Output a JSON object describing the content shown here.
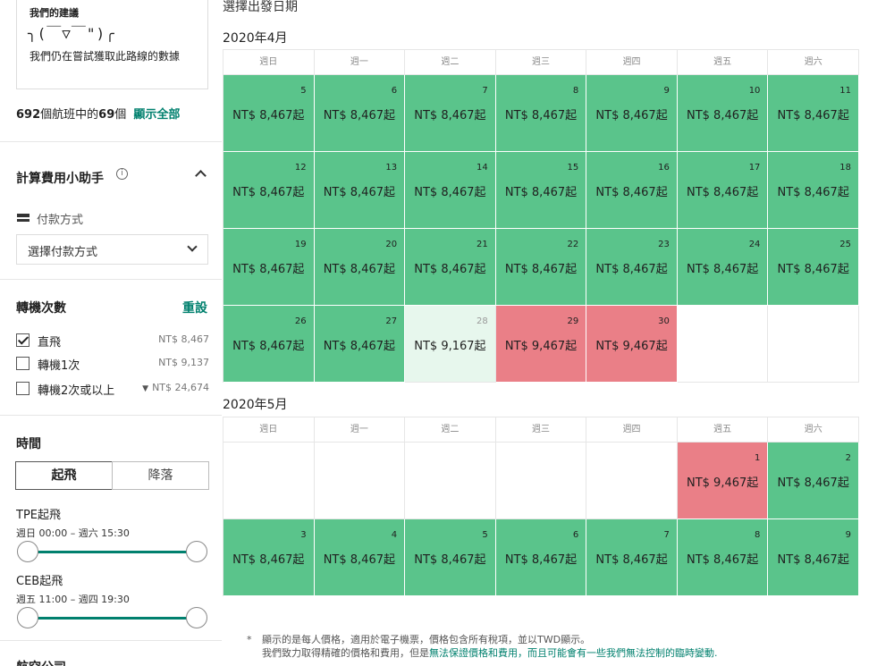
{
  "sidebar": {
    "suggestion": {
      "title": "我們的建議",
      "face": "╮(￣▽￣\")╭",
      "text": "我們仍在嘗試獲取此路線的數據"
    },
    "flight_count": {
      "total": "692",
      "text1": "個航班中的",
      "shown": "69",
      "text2": "個",
      "show_all": "顯示全部"
    },
    "calculator": {
      "title": "計算費用小助手",
      "info_icon": "info-icon",
      "payment_label": "付款方式",
      "payment_placeholder": "選擇付款方式"
    },
    "stops": {
      "title": "轉機次數",
      "reset": "重設",
      "options": [
        {
          "label": "直飛",
          "price": "NT$ 8,467",
          "checked": true
        },
        {
          "label": "轉機1次",
          "price": "NT$ 9,137",
          "checked": false
        },
        {
          "label": "轉機2次或以上",
          "price": "NT$ 24,674",
          "checked": false,
          "filter_icon": "▼"
        }
      ]
    },
    "time": {
      "title": "時間",
      "tab_depart": "起飛",
      "tab_arrive": "降落",
      "ranges": [
        {
          "title": "TPE起飛",
          "sub": "週日 00:00 – 週六 15:30"
        },
        {
          "title": "CEB起飛",
          "sub": "週五 11:00 – 週四 19:30"
        }
      ]
    },
    "airlines_title": "航空公司"
  },
  "calendar": {
    "heading": "選擇出發日期",
    "weekdays": [
      "週日",
      "週一",
      "週二",
      "週三",
      "週四",
      "週五",
      "週六"
    ],
    "colors": {
      "green": "#5ac48b",
      "light": "#e7f7ed",
      "red": "#ea7f87"
    },
    "months": [
      {
        "label": "2020年4月",
        "cells": [
          {
            "day": "5",
            "price": "NT$ 8,467起",
            "level": "green"
          },
          {
            "day": "6",
            "price": "NT$ 8,467起",
            "level": "green"
          },
          {
            "day": "7",
            "price": "NT$ 8,467起",
            "level": "green"
          },
          {
            "day": "8",
            "price": "NT$ 8,467起",
            "level": "green"
          },
          {
            "day": "9",
            "price": "NT$ 8,467起",
            "level": "green"
          },
          {
            "day": "10",
            "price": "NT$ 8,467起",
            "level": "green"
          },
          {
            "day": "11",
            "price": "NT$ 8,467起",
            "level": "green"
          },
          {
            "day": "12",
            "price": "NT$ 8,467起",
            "level": "green"
          },
          {
            "day": "13",
            "price": "NT$ 8,467起",
            "level": "green"
          },
          {
            "day": "14",
            "price": "NT$ 8,467起",
            "level": "green"
          },
          {
            "day": "15",
            "price": "NT$ 8,467起",
            "level": "green"
          },
          {
            "day": "16",
            "price": "NT$ 8,467起",
            "level": "green"
          },
          {
            "day": "17",
            "price": "NT$ 8,467起",
            "level": "green"
          },
          {
            "day": "18",
            "price": "NT$ 8,467起",
            "level": "green"
          },
          {
            "day": "19",
            "price": "NT$ 8,467起",
            "level": "green"
          },
          {
            "day": "20",
            "price": "NT$ 8,467起",
            "level": "green"
          },
          {
            "day": "21",
            "price": "NT$ 8,467起",
            "level": "green"
          },
          {
            "day": "22",
            "price": "NT$ 8,467起",
            "level": "green"
          },
          {
            "day": "23",
            "price": "NT$ 8,467起",
            "level": "green"
          },
          {
            "day": "24",
            "price": "NT$ 8,467起",
            "level": "green"
          },
          {
            "day": "25",
            "price": "NT$ 8,467起",
            "level": "green"
          },
          {
            "day": "26",
            "price": "NT$ 8,467起",
            "level": "green"
          },
          {
            "day": "27",
            "price": "NT$ 8,467起",
            "level": "green"
          },
          {
            "day": "28",
            "price": "NT$ 9,167起",
            "level": "light"
          },
          {
            "day": "29",
            "price": "NT$ 9,467起",
            "level": "red"
          },
          {
            "day": "30",
            "price": "NT$ 9,467起",
            "level": "red"
          },
          {
            "day": "",
            "price": "",
            "level": "empty"
          },
          {
            "day": "",
            "price": "",
            "level": "empty"
          }
        ]
      },
      {
        "label": "2020年5月",
        "cells": [
          {
            "day": "",
            "price": "",
            "level": "empty"
          },
          {
            "day": "",
            "price": "",
            "level": "empty"
          },
          {
            "day": "",
            "price": "",
            "level": "empty"
          },
          {
            "day": "",
            "price": "",
            "level": "empty"
          },
          {
            "day": "",
            "price": "",
            "level": "empty"
          },
          {
            "day": "1",
            "price": "NT$ 9,467起",
            "level": "red"
          },
          {
            "day": "2",
            "price": "NT$ 8,467起",
            "level": "green"
          },
          {
            "day": "3",
            "price": "NT$ 8,467起",
            "level": "green"
          },
          {
            "day": "4",
            "price": "NT$ 8,467起",
            "level": "green"
          },
          {
            "day": "5",
            "price": "NT$ 8,467起",
            "level": "green"
          },
          {
            "day": "6",
            "price": "NT$ 8,467起",
            "level": "green"
          },
          {
            "day": "7",
            "price": "NT$ 8,467起",
            "level": "green"
          },
          {
            "day": "8",
            "price": "NT$ 8,467起",
            "level": "green"
          },
          {
            "day": "9",
            "price": "NT$ 8,467起",
            "level": "green"
          }
        ]
      }
    ]
  },
  "footnote": {
    "star": "*",
    "line1": "顯示的是每人價格，適用於電子機票，價格包含所有稅項，並以TWD顯示。",
    "line2_pre": "我們致力取得精確的價格和費用，但是",
    "line2_link": "無法保證價格和費用，而且可能會有一些我們無法控制的臨時變動."
  }
}
